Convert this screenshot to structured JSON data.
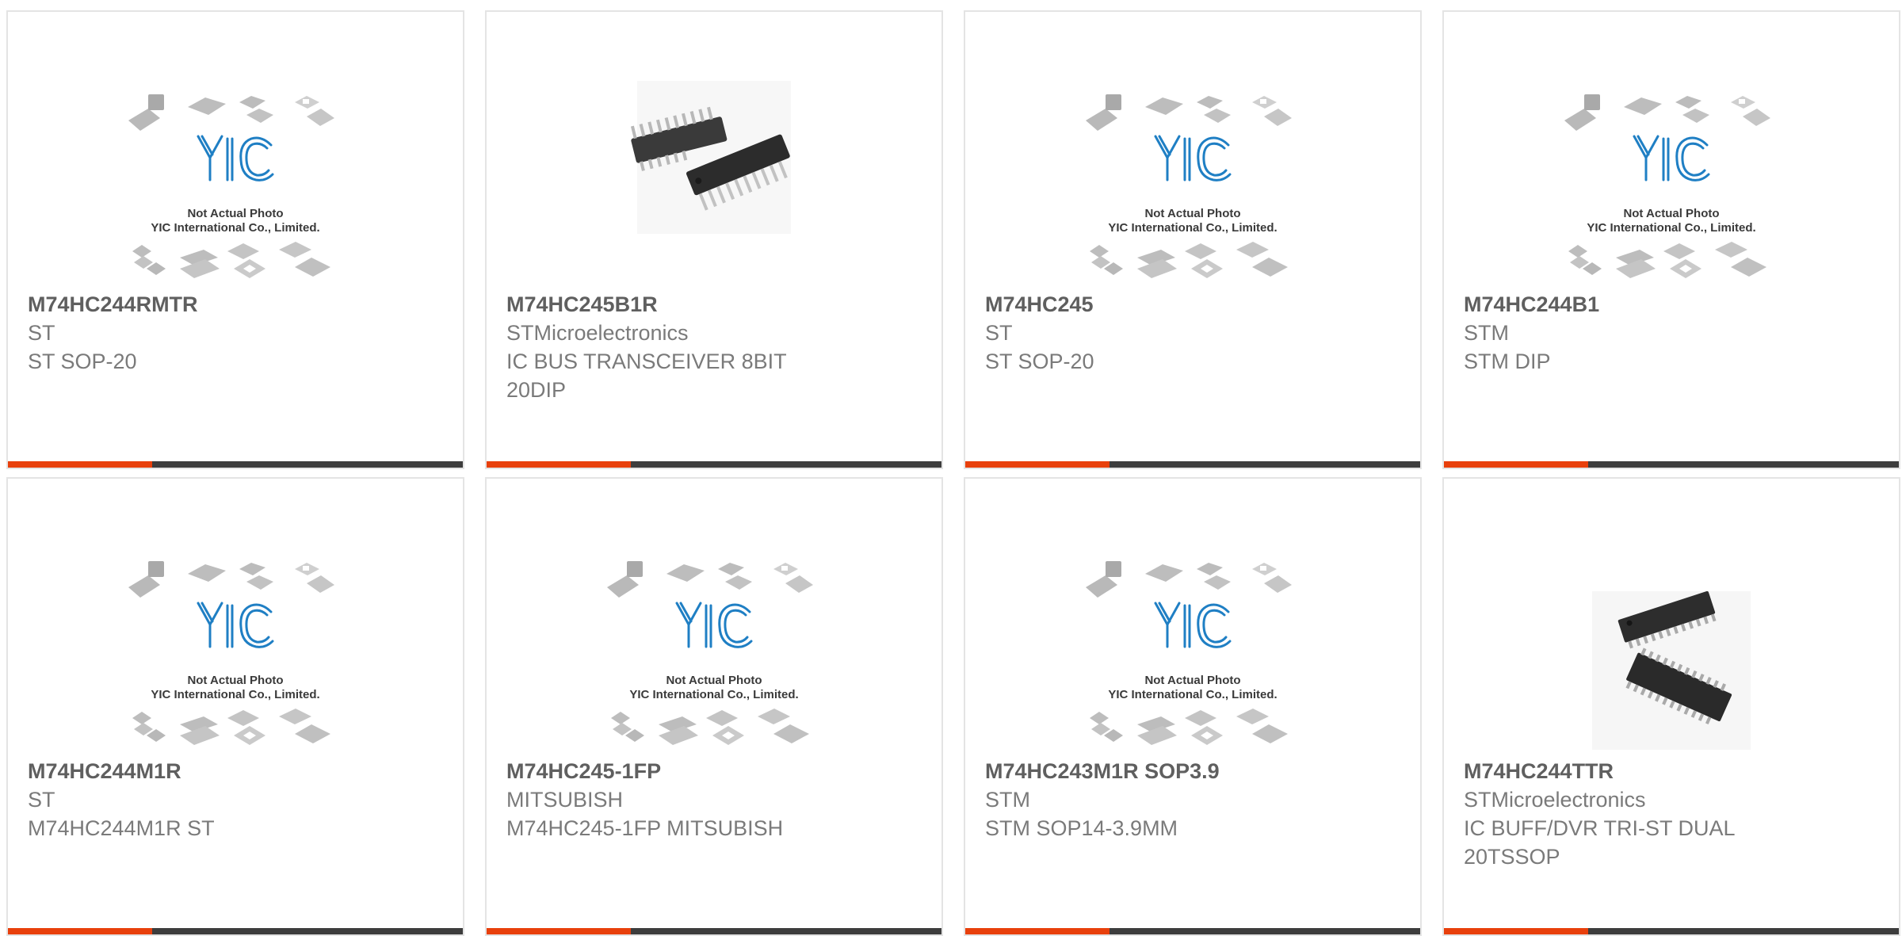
{
  "placeholder": {
    "logo_text": "YIC",
    "caption_line1": "Not Actual Photo",
    "caption_line2": "YIC International Co., Limited."
  },
  "colors": {
    "accent": "#e8400c",
    "bar": "#3d3d3d",
    "logo_blue": "#1f7fc4"
  },
  "products": [
    {
      "part": "M74HC244RMTR",
      "manufacturer": "ST",
      "description": "ST SOP-20",
      "image": "placeholder-image"
    },
    {
      "part": "M74HC245B1R",
      "manufacturer": "STMicroelectronics",
      "description": "IC BUS TRANSCEIVER 8BIT 20DIP",
      "image": "dip-chip-photo"
    },
    {
      "part": "M74HC245",
      "manufacturer": "ST",
      "description": "ST SOP-20",
      "image": "placeholder-image"
    },
    {
      "part": "M74HC244B1",
      "manufacturer": "STM",
      "description": "STM DIP",
      "image": "placeholder-image"
    },
    {
      "part": "M74HC244M1R",
      "manufacturer": "ST",
      "description": "M74HC244M1R ST",
      "image": "placeholder-image"
    },
    {
      "part": "M74HC245-1FP",
      "manufacturer": "MITSUBISH",
      "description": "M74HC245-1FP MITSUBISH",
      "image": "placeholder-image"
    },
    {
      "part": "M74HC243M1R SOP3.9",
      "manufacturer": "STM",
      "description": "STM SOP14-3.9MM",
      "image": "placeholder-image"
    },
    {
      "part": "M74HC244TTR",
      "manufacturer": "STMicroelectronics",
      "description": "IC BUFF/DVR TRI-ST DUAL 20TSSOP",
      "image": "tssop-chip-photo"
    }
  ]
}
